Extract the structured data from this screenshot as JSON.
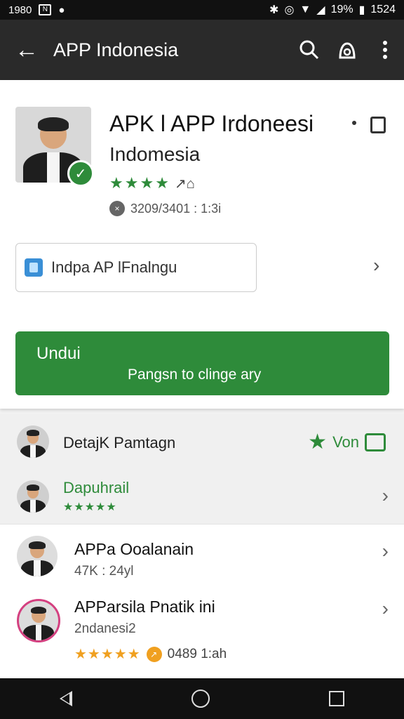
{
  "status_bar": {
    "left_text": "1980",
    "battery": "19%",
    "time": "1524"
  },
  "app_bar": {
    "title": "APP Indonesia"
  },
  "app": {
    "title": "APK l APP Irdoneesi",
    "subtitle": "Indomesia",
    "rating_extra": "↗⌂",
    "meta": "3209/3401 : 1:3i"
  },
  "info_box": {
    "label": "Indpa AP lFnalngu"
  },
  "download": {
    "label": "Undui",
    "sub": "Pangsn to clinge ary"
  },
  "list": {
    "row1": {
      "title": "DetajK Pamtagn",
      "vote_label": "Von"
    },
    "row2": {
      "title": "Dapuhrail",
      "stars": "★★★★★"
    }
  },
  "items": [
    {
      "title": "APPa Ooalanain",
      "sub": "47K : 24yl"
    },
    {
      "title": "APParsila Pnatik ini",
      "sub": "2ndanesi2",
      "stars": "★★★★★",
      "meta": "0489 1:ah"
    }
  ],
  "colors": {
    "accent_green": "#2e8b3a",
    "app_bar": "#2a2a2a",
    "orange": "#f0a020"
  }
}
